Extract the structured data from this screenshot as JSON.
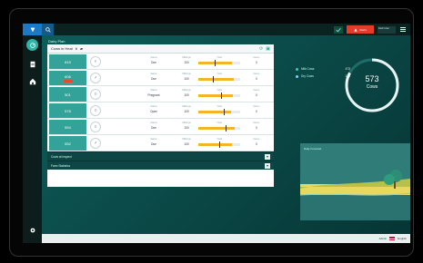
{
  "header": {
    "left_title": "Dairy Plan",
    "alert_label": "Alerts",
    "user_label": "Farm User"
  },
  "main": {
    "title": "Dairy Plan"
  },
  "list": {
    "selector": "Cows in Heat",
    "count": "6",
    "rows": [
      {
        "id": "815",
        "status": "Due",
        "milk": "100",
        "inst": "0"
      },
      {
        "id": "606",
        "status": "Due",
        "milk": "100",
        "inst": "0",
        "flag": true
      },
      {
        "id": "501",
        "status": "Pregnant",
        "milk": "100",
        "inst": "0"
      },
      {
        "id": "578",
        "status": "Open",
        "milk": "100",
        "inst": "0"
      },
      {
        "id": "554",
        "status": "Due",
        "milk": "100",
        "inst": "0"
      },
      {
        "id": "552",
        "status": "Due",
        "milk": "100",
        "inst": "0"
      }
    ],
    "column_labels": {
      "status": "Status",
      "milk": "Milkings",
      "bar": "Yield",
      "inst": "Insem."
    }
  },
  "subsections": {
    "one": "Cows at Inspect",
    "two": "Farm Statistics"
  },
  "stats": {
    "legend": [
      {
        "label": "Milk Cows",
        "value": "473",
        "color": "#2fd0c0"
      },
      {
        "label": "Dry Cows",
        "value": "100",
        "color": "#7fd2ff"
      }
    ],
    "donut_value": "573",
    "donut_label": "Cows",
    "donut_fraction": 0.83
  },
  "card": {
    "title": "Daily Forecast"
  },
  "footer": {
    "user": "Admin",
    "lang": "English"
  },
  "colors": {
    "teal_bg": "#0e5f5d",
    "accent": "#33a39a",
    "alert_red": "#e53b2a",
    "bar_yellow": "#f0b628"
  }
}
